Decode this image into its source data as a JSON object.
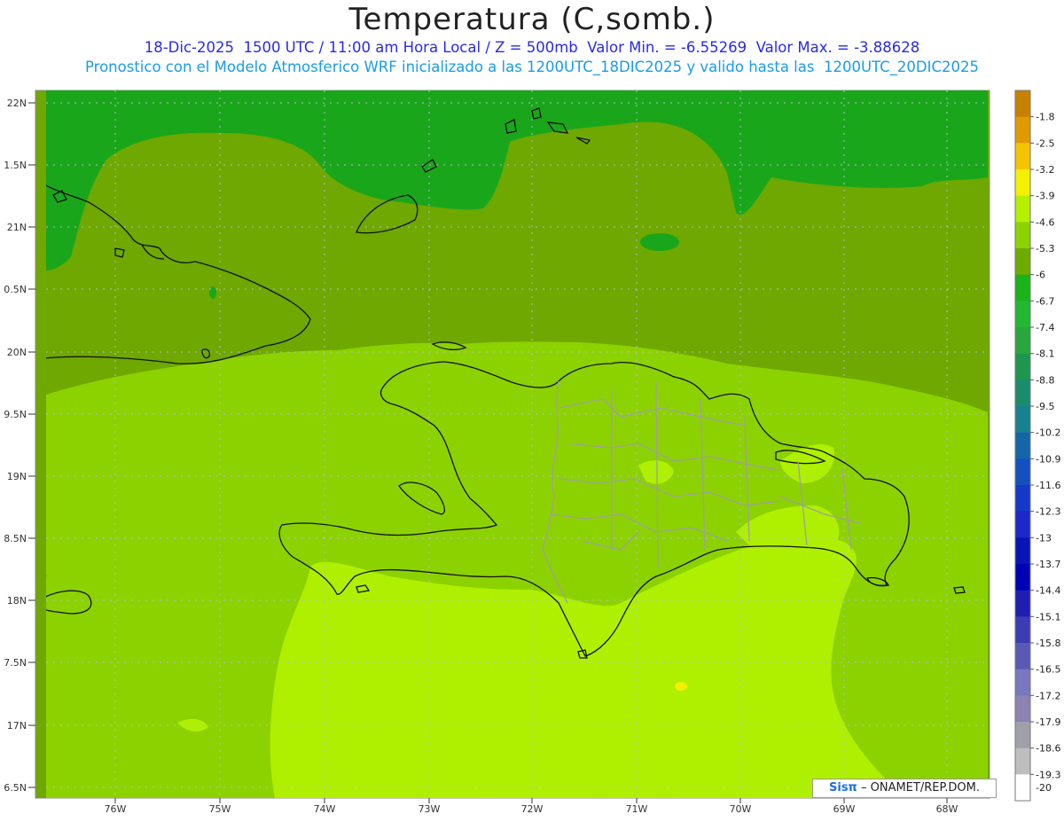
{
  "header": {
    "title": "Temperatura (C,somb.)",
    "subtitle_line1": "18-Dic-2025  1500 UTC / 11:00 am Hora Local / Z = 500mb  Valor Min. = -6.55269  Valor Max. = -3.88628",
    "subtitle_line2": "Pronostico con el Modelo Atmosferico WRF inicializado a las 1200UTC_18DIC2025 y valido hasta las  1200UTC_20DIC2025"
  },
  "axes": {
    "lat_labels": [
      "22N",
      "1.5N",
      "21N",
      "0.5N",
      "20N",
      "9.5N",
      "19N",
      "8.5N",
      "18N",
      "7.5N",
      "17N",
      "6.5N"
    ],
    "lon_labels": [
      "76W",
      "75W",
      "74W",
      "73W",
      "72W",
      "71W",
      "70W",
      "69W",
      "68W"
    ]
  },
  "colorbar": {
    "labels": [
      "-1.8",
      "-2.5",
      "-3.2",
      "-3.9",
      "-4.6",
      "-5.3",
      "-6",
      "-6.7",
      "-7.4",
      "-8.1",
      "-8.8",
      "-9.5",
      "-10.2",
      "-10.9",
      "-11.6",
      "-12.3",
      "-13",
      "-13.7",
      "-14.4",
      "-15.1",
      "-15.8",
      "-16.5",
      "-17.2",
      "-17.9",
      "-18.6",
      "-19.3",
      "-20"
    ],
    "colors": [
      "#c88000",
      "#e09a00",
      "#f5c400",
      "#f5f000",
      "#b4f000",
      "#8cd200",
      "#6eaa00",
      "#1ab31a",
      "#22b832",
      "#28a83c",
      "#1e9650",
      "#1a8c6e",
      "#168290",
      "#1466a8",
      "#1450c0",
      "#1438c8",
      "#1e28c8",
      "#0a14b4",
      "#0000b4",
      "#1e1eb4",
      "#3c3cb4",
      "#5a5ab4",
      "#7878be",
      "#8c82b4",
      "#a0a0aa",
      "#bebebe",
      "#ffffff"
    ]
  },
  "footer": {
    "logo": "Sisπ",
    "credit": " – ONAMET/REP.DOM."
  }
}
